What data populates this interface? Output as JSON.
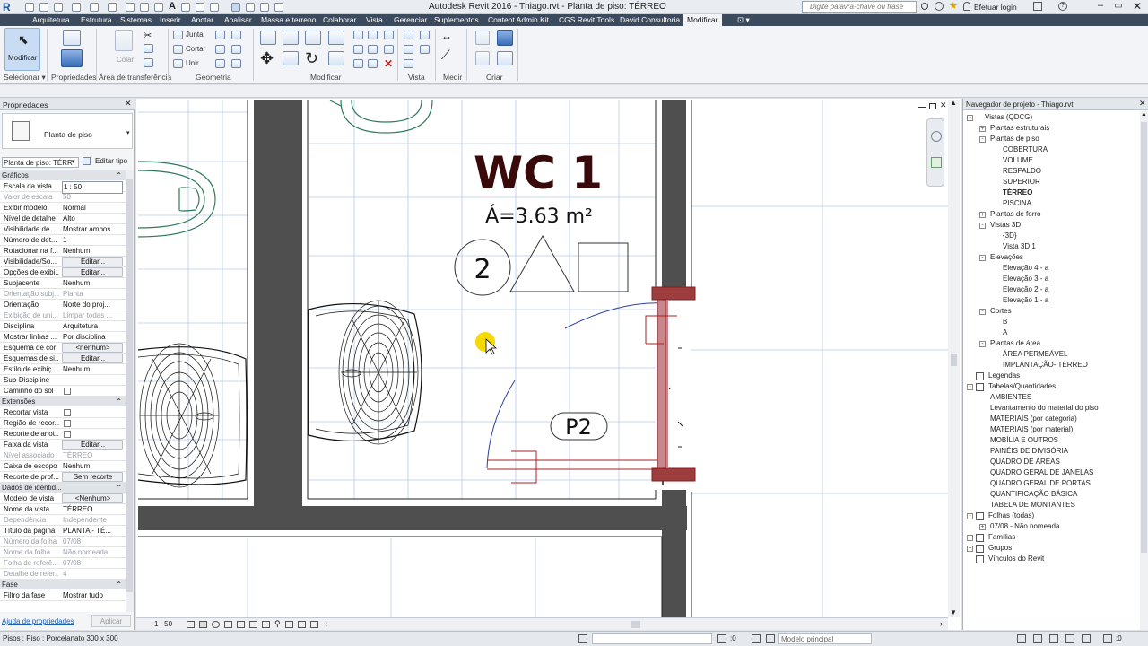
{
  "app": {
    "title": "Autodesk Revit 2016 -",
    "document": "Thiago.rvt - Planta de piso: TÉRREO",
    "search_placeholder": "Digite palavra-chave ou frase",
    "login": "Efetuar login"
  },
  "ribbon_tabs": [
    "Arquitetura",
    "Estrutura",
    "Sistemas",
    "Inserir",
    "Anotar",
    "Analisar",
    "Massa e terreno",
    "Colaborar",
    "Vista",
    "Gerenciar",
    "Suplementos",
    "Content Admin Kit",
    "CGS Revit Tools",
    "David Consultoria",
    "Modificar"
  ],
  "active_tab": "Modificar",
  "ribbon": {
    "modify_label": "Modificar",
    "paste_label": "Colar",
    "join_label": "Junta",
    "cut_label": "Cortar",
    "unite_label": "Unir",
    "panels": {
      "select": "Selecionar",
      "properties": "Propriedades",
      "clipboard": "Área de transferência",
      "geometry": "Geometria",
      "modify": "Modificar",
      "view": "Vista",
      "measure": "Medir",
      "create": "Criar"
    }
  },
  "properties": {
    "title": "Propriedades",
    "type_name": "Planta de piso",
    "view_selector": "Planta de piso: TÉRR",
    "edit_type": "Editar tipo",
    "sections": {
      "graphics": "Gráficos",
      "extents": "Extensões",
      "identity": "Dados de identid...",
      "phase": "Fase"
    },
    "graphics_rows": [
      {
        "k": "Escala da vista",
        "v": "1 : 50",
        "style": "boxed"
      },
      {
        "k": "Valor de escala",
        "v": "50",
        "dim": true
      },
      {
        "k": "Exibir modelo",
        "v": "Normal"
      },
      {
        "k": "Nível de detalhe",
        "v": "Alto"
      },
      {
        "k": "Visibilidade de ...",
        "v": "Mostrar ambos"
      },
      {
        "k": "Número de det...",
        "v": "1"
      },
      {
        "k": "Rotacionar na f...",
        "v": "Nenhum"
      },
      {
        "k": "Visibilidade/So...",
        "v": "Editar...",
        "style": "btn"
      },
      {
        "k": "Opções de exibi...",
        "v": "Editar...",
        "style": "btn"
      },
      {
        "k": "Subjacente",
        "v": "Nenhum"
      },
      {
        "k": "Orientação subj...",
        "v": "Planta",
        "dim": true
      },
      {
        "k": "Orientação",
        "v": "Norte do proj..."
      },
      {
        "k": "Exibição de uni...",
        "v": "Limpar todas ...",
        "dim": true
      },
      {
        "k": "Disciplina",
        "v": "Arquitetura"
      },
      {
        "k": "Mostrar linhas ...",
        "v": "Por disciplina"
      },
      {
        "k": "Esquema de cor",
        "v": "<nenhum>",
        "style": "btn"
      },
      {
        "k": "Esquemas de si...",
        "v": "Editar...",
        "style": "btn"
      },
      {
        "k": "Estilo de exibiç...",
        "v": "Nenhum"
      },
      {
        "k": "Sub-Discipline",
        "v": ""
      },
      {
        "k": "Caminho do sol",
        "v": "",
        "style": "check"
      }
    ],
    "extents_rows": [
      {
        "k": "Recortar vista",
        "v": "",
        "style": "check"
      },
      {
        "k": "Região de recor...",
        "v": "",
        "style": "check"
      },
      {
        "k": "Recorte de anot...",
        "v": "",
        "style": "check"
      },
      {
        "k": "Faixa da vista",
        "v": "Editar...",
        "style": "btn"
      },
      {
        "k": "Nível associado",
        "v": "TÉRREO",
        "dim": true
      },
      {
        "k": "Caixa de escopo",
        "v": "Nenhum"
      },
      {
        "k": "Recorte de prof...",
        "v": "Sem recorte",
        "style": "btn"
      }
    ],
    "identity_rows": [
      {
        "k": "Modelo de vista",
        "v": "<Nenhum>",
        "style": "btn"
      },
      {
        "k": "Nome da vista",
        "v": "TÉRREO"
      },
      {
        "k": "Dependência",
        "v": "Independente",
        "dim": true
      },
      {
        "k": "Título da página",
        "v": "PLANTA - TÉ..."
      },
      {
        "k": "Número da folha",
        "v": "07/08",
        "dim": true
      },
      {
        "k": "Nome da folha",
        "v": "Não nomeada",
        "dim": true
      },
      {
        "k": "Folha de referê...",
        "v": "07/08",
        "dim": true
      },
      {
        "k": "Detalhe de refer...",
        "v": "4",
        "dim": true
      }
    ],
    "phase_rows": [
      {
        "k": "Filtro da fase",
        "v": "Mostrar tudo"
      }
    ],
    "help_link": "Ajuda de propriedades",
    "apply": "Aplicar"
  },
  "canvas": {
    "room_name": "WC 1",
    "room_area": "Á=3.63 m²",
    "tag_number": "2",
    "door_tag": "P2",
    "scale": "1 : 50"
  },
  "browser": {
    "title": "Navegador de projeto - Thiago.rvt",
    "items": [
      {
        "t": "Vistas (QDCG)",
        "lvl": 0,
        "tw": "-"
      },
      {
        "t": "Plantas estruturais",
        "lvl": 1,
        "tw": "+"
      },
      {
        "t": "Plantas de piso",
        "lvl": 1,
        "tw": "-"
      },
      {
        "t": "COBERTURA",
        "lvl": 2
      },
      {
        "t": "VOLUME",
        "lvl": 2
      },
      {
        "t": "RESPALDO",
        "lvl": 2
      },
      {
        "t": "SUPERIOR",
        "lvl": 2
      },
      {
        "t": "TÉRREO",
        "lvl": 2,
        "bold": true
      },
      {
        "t": "PISCINA",
        "lvl": 2
      },
      {
        "t": "Plantas de forro",
        "lvl": 1,
        "tw": "+"
      },
      {
        "t": "Vistas 3D",
        "lvl": 1,
        "tw": "-"
      },
      {
        "t": "{3D}",
        "lvl": 2
      },
      {
        "t": "Vista 3D 1",
        "lvl": 2
      },
      {
        "t": "Elevações",
        "lvl": 1,
        "tw": "-"
      },
      {
        "t": "Elevação 4 - a",
        "lvl": 2
      },
      {
        "t": "Elevação 3 - a",
        "lvl": 2
      },
      {
        "t": "Elevação 2 - a",
        "lvl": 2
      },
      {
        "t": "Elevação 1 - a",
        "lvl": 2
      },
      {
        "t": "Cortes",
        "lvl": 1,
        "tw": "-"
      },
      {
        "t": "B",
        "lvl": 2
      },
      {
        "t": "A",
        "lvl": 2
      },
      {
        "t": "Plantas de área",
        "lvl": 1,
        "tw": "-"
      },
      {
        "t": "ÁREA PERMEÁVEL",
        "lvl": 2
      },
      {
        "t": "IMPLANTAÇÃO- TÉRREO",
        "lvl": 2
      },
      {
        "t": "Legendas",
        "lvl": 0,
        "icon": true
      },
      {
        "t": "Tabelas/Quantidades",
        "lvl": 0,
        "tw": "-",
        "icon": true
      },
      {
        "t": "AMBIENTES",
        "lvl": 1
      },
      {
        "t": "Levantamento do material do piso",
        "lvl": 1
      },
      {
        "t": "MATERIAIS (por categoria)",
        "lvl": 1
      },
      {
        "t": "MATERIAIS (por material)",
        "lvl": 1
      },
      {
        "t": "MOBÍLIA E OUTROS",
        "lvl": 1
      },
      {
        "t": "PAINÉIS DE DIVISÓRIA",
        "lvl": 1
      },
      {
        "t": "QUADRO DE ÁREAS",
        "lvl": 1
      },
      {
        "t": "QUADRO GERAL DE JANELAS",
        "lvl": 1
      },
      {
        "t": "QUADRO GERAL DE PORTAS",
        "lvl": 1
      },
      {
        "t": "QUANTIFICAÇÃO BÁSICA",
        "lvl": 1
      },
      {
        "t": "TABELA DE MONTANTES",
        "lvl": 1
      },
      {
        "t": "Folhas (todas)",
        "lvl": 0,
        "tw": "-",
        "icon": true
      },
      {
        "t": "07/08 - Não nomeada",
        "lvl": 1,
        "tw": "+"
      },
      {
        "t": "Famílias",
        "lvl": 0,
        "tw": "+",
        "icon": true
      },
      {
        "t": "Grupos",
        "lvl": 0,
        "tw": "+",
        "icon": true
      },
      {
        "t": "Vínculos do Revit",
        "lvl": 0,
        "icon": true
      }
    ]
  },
  "status": {
    "left": "Pisos : Piso : Porcelanato 300 x 300",
    "counter": ":0",
    "model": "Modelo principal"
  }
}
